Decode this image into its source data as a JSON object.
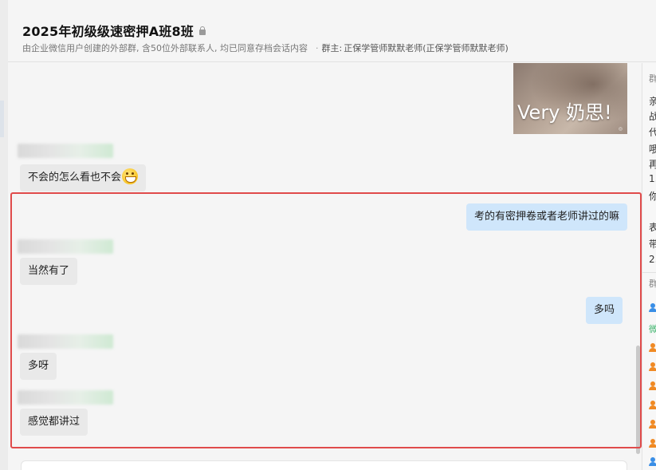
{
  "header": {
    "title": "2025年初级级速密押A班8班",
    "subtitle": "由企业微信用户创建的外部群, 含50位外部联系人, 均已同意存档会话内容",
    "owner_label": "群主:",
    "owner_name": "正保学管师默默老师(正保学管师默默老师)"
  },
  "messages": {
    "image_caption": "Very 奶思!",
    "m1": "不会的怎么看也不会",
    "m2": "考的有密押卷或者老师讲过的嘛",
    "m3": "当然有了",
    "m4": "多吗",
    "m5": "多呀",
    "m6": "感觉都讲过"
  },
  "right_panel": {
    "section1_label": "群",
    "notice_lines": [
      "亲",
      "战",
      "代",
      "哦",
      "再",
      "1.",
      "你",
      "表",
      "带",
      "2."
    ],
    "section2_label": "群",
    "members": [
      {
        "icon": "member-icon",
        "color": "#3a8ee6"
      },
      {
        "label": "微",
        "color": "#3bb56b"
      },
      {
        "icon": "member-icon",
        "color": "#f08a24"
      },
      {
        "icon": "member-icon",
        "color": "#f08a24"
      },
      {
        "icon": "member-icon",
        "color": "#f08a24"
      },
      {
        "icon": "member-icon",
        "color": "#f08a24"
      },
      {
        "icon": "member-icon",
        "color": "#f08a24"
      },
      {
        "icon": "member-icon",
        "color": "#f08a24"
      },
      {
        "icon": "member-icon",
        "color": "#3a8ee6"
      }
    ]
  },
  "colors": {
    "highlight_border": "#e04b4b",
    "outgoing_bubble": "#cfe6fb",
    "incoming_bubble": "#e9e9e9"
  }
}
